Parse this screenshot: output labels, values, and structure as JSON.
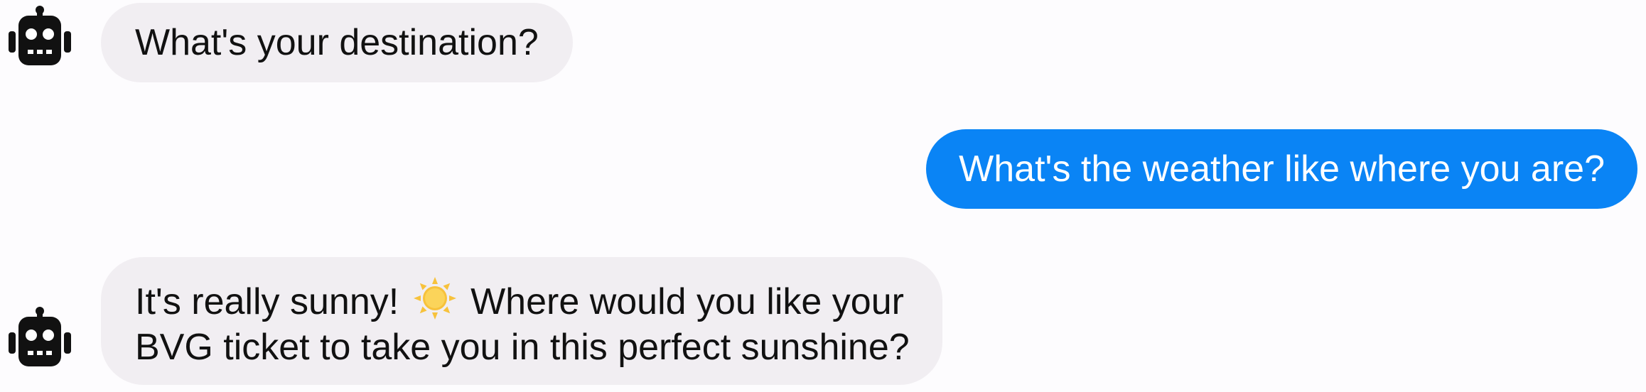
{
  "conversation": {
    "messages": [
      {
        "sender": "bot",
        "avatar_icon": "robot-icon",
        "text": "What's your destination?"
      },
      {
        "sender": "user",
        "text": "What's the weather like where you are?"
      },
      {
        "sender": "bot",
        "avatar_icon": "robot-icon",
        "line1_before_icon": "It's really sunny!",
        "inline_icon": "sun-icon",
        "line1_after_icon": "Where would you like your",
        "line2": "BVG ticket to take you in this perfect sunshine?"
      }
    ]
  },
  "colors": {
    "user_bubble": "#0a84f5",
    "bot_bubble": "#f1eef2",
    "background": "#fdfcfe",
    "sun": "#f7c23c"
  }
}
